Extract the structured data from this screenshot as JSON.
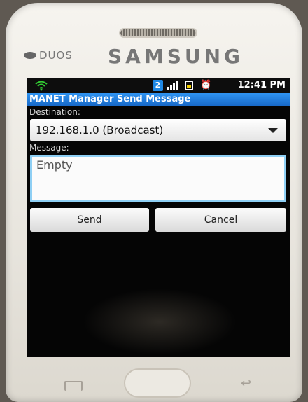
{
  "device": {
    "dual_sim_label": "DUOS",
    "brand": "SAMSUNG"
  },
  "statusbar": {
    "sim_indicator": "2",
    "time": "12:41 PM",
    "icons": [
      "wifi-icon",
      "signal-icon",
      "battery-icon",
      "alarm-icon"
    ],
    "accent_sim": "#1e88e5"
  },
  "app": {
    "title": "MANET Manager Send Message",
    "title_bar_color": "#1f7fe0"
  },
  "form": {
    "destination_label": "Destination:",
    "destination_value": "192.168.1.0 (Broadcast)",
    "message_label": "Message:",
    "message_value": "Empty",
    "send_label": "Send",
    "cancel_label": "Cancel"
  }
}
